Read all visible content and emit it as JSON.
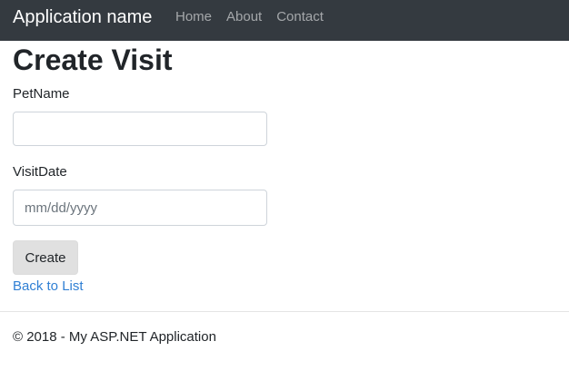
{
  "navbar": {
    "brand": "Application name",
    "links": [
      "Home",
      "About",
      "Contact"
    ],
    "background": "#343a40"
  },
  "page": {
    "title": "Create Visit"
  },
  "form": {
    "pet_name": {
      "label": "PetName",
      "value": ""
    },
    "visit_date": {
      "label": "VisitDate",
      "placeholder": "mm/dd/yyyy"
    },
    "submit_label": "Create",
    "back_link": "Back to List"
  },
  "footer": {
    "text": "© 2018 - My ASP.NET Application"
  }
}
